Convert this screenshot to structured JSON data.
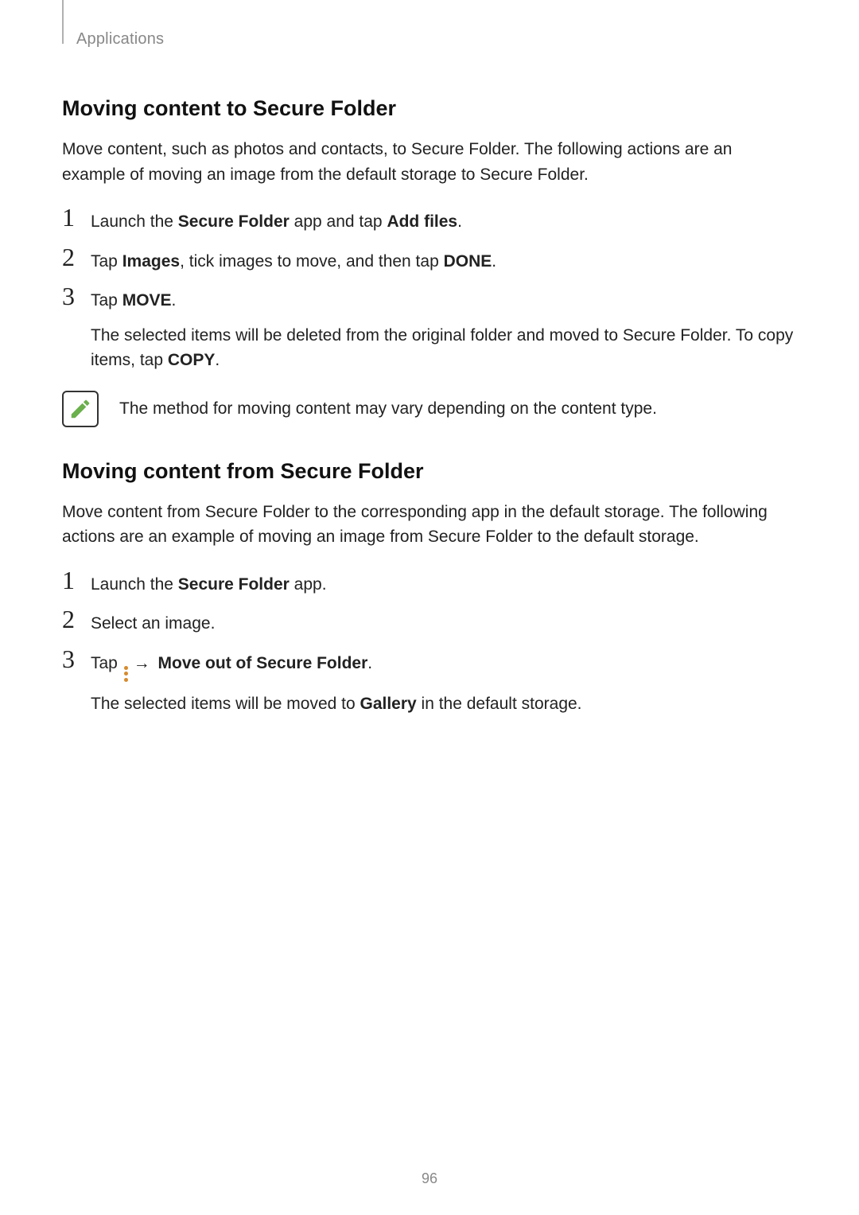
{
  "header": {
    "breadcrumb": "Applications"
  },
  "section1": {
    "heading": "Moving content to Secure Folder",
    "intro": "Move content, such as photos and contacts, to Secure Folder. The following actions are an example of moving an image from the default storage to Secure Folder.",
    "step1": {
      "num": "1",
      "prefix": "Launch the ",
      "bold1": "Secure Folder",
      "mid": " app and tap ",
      "bold2": "Add files",
      "suffix": "."
    },
    "step2": {
      "num": "2",
      "prefix": "Tap ",
      "bold1": "Images",
      "mid": ", tick images to move, and then tap ",
      "bold2": "DONE",
      "suffix": "."
    },
    "step3": {
      "num": "3",
      "prefix": "Tap ",
      "bold1": "MOVE",
      "suffix": ".",
      "sub_prefix": "The selected items will be deleted from the original folder and moved to Secure Folder. To copy items, tap ",
      "sub_bold": "COPY",
      "sub_suffix": "."
    },
    "note": "The method for moving content may vary depending on the content type."
  },
  "section2": {
    "heading": "Moving content from Secure Folder",
    "intro": "Move content from Secure Folder to the corresponding app in the default storage. The following actions are an example of moving an image from Secure Folder to the default storage.",
    "step1": {
      "num": "1",
      "prefix": "Launch the ",
      "bold1": "Secure Folder",
      "suffix": " app."
    },
    "step2": {
      "num": "2",
      "text": "Select an image."
    },
    "step3": {
      "num": "3",
      "prefix": "Tap ",
      "arrow": "→",
      "bold1": "Move out of Secure Folder",
      "suffix": ".",
      "sub_prefix": "The selected items will be moved to ",
      "sub_bold": "Gallery",
      "sub_suffix": " in the default storage."
    }
  },
  "page_number": "96"
}
